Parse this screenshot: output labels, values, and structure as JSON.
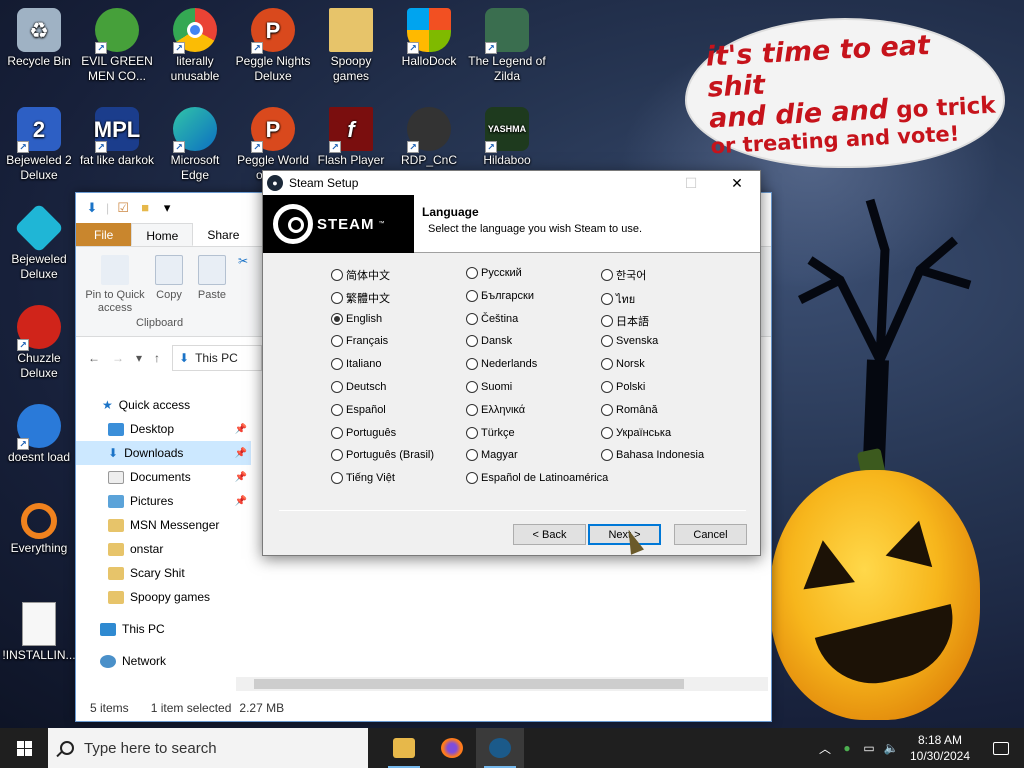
{
  "desktop": {
    "icons": [
      {
        "label": "Recycle Bin"
      },
      {
        "label": "EVIL GREEN MEN CO..."
      },
      {
        "label": "literally unusable"
      },
      {
        "label": "Peggle Nights Deluxe"
      },
      {
        "label": "Spoopy games"
      },
      {
        "label": "HalloDock"
      },
      {
        "label": "The Legend of Zilda"
      },
      {
        "label": "Bejeweled 2 Deluxe"
      },
      {
        "label": "fat like darkok"
      },
      {
        "label": "Microsoft Edge"
      },
      {
        "label": "Peggle World of W..."
      },
      {
        "label": "Flash Player"
      },
      {
        "label": "RDP_CnC"
      },
      {
        "label": "Hildaboo"
      },
      {
        "label": "Bejeweled Deluxe"
      },
      {
        "label": "Chuzzle Deluxe"
      },
      {
        "label": "doesnt load"
      },
      {
        "label": "Everything"
      },
      {
        "label": "!INSTALLIN..."
      }
    ],
    "wallpaper_text": {
      "line1": "it's time to eat shit",
      "line2a": "and die and",
      "line2b": " go trick",
      "line3": "or treating and vote!"
    }
  },
  "explorer": {
    "ribbon_tabs": [
      "File",
      "Home",
      "Share"
    ],
    "ribbon_buttons": {
      "pin": "Pin to Quick access",
      "copy": "Copy",
      "paste": "Paste"
    },
    "ribbon_group": "Clipboard",
    "address": "This PC",
    "nav": [
      {
        "label": "Quick access"
      },
      {
        "label": "Desktop"
      },
      {
        "label": "Downloads"
      },
      {
        "label": "Documents"
      },
      {
        "label": "Pictures"
      },
      {
        "label": "MSN Messenger"
      },
      {
        "label": "onstar"
      },
      {
        "label": "Scary Shit"
      },
      {
        "label": "Spoopy games"
      },
      {
        "label": "This PC"
      },
      {
        "label": "Network"
      }
    ],
    "status": {
      "items": "5 items",
      "selected": "1 item selected",
      "size": "2.27 MB"
    }
  },
  "dialog": {
    "title": "Steam Setup",
    "logo_text": "STEAM",
    "header_title": "Language",
    "header_subtitle": "Select the language you wish Steam to use.",
    "languages": [
      "简体中文",
      "繁體中文",
      "English",
      "Français",
      "Italiano",
      "Deutsch",
      "Español",
      "Português",
      "Português (Brasil)",
      "Tiếng Việt",
      "Русский",
      "Български",
      "Čeština",
      "Dansk",
      "Nederlands",
      "Suomi",
      "Ελληνικά",
      "Türkçe",
      "Magyar",
      "Español de Latinoamérica",
      "한국어",
      "ไทย",
      "日本語",
      "Svenska",
      "Norsk",
      "Polski",
      "Română",
      "Українська",
      "Bahasa Indonesia"
    ],
    "selected_language": "English",
    "buttons": {
      "back": "< Back",
      "next": "Next >",
      "cancel": "Cancel"
    }
  },
  "taskbar": {
    "search_placeholder": "Type here to search",
    "time": "8:18 AM",
    "date": "10/30/2024"
  }
}
